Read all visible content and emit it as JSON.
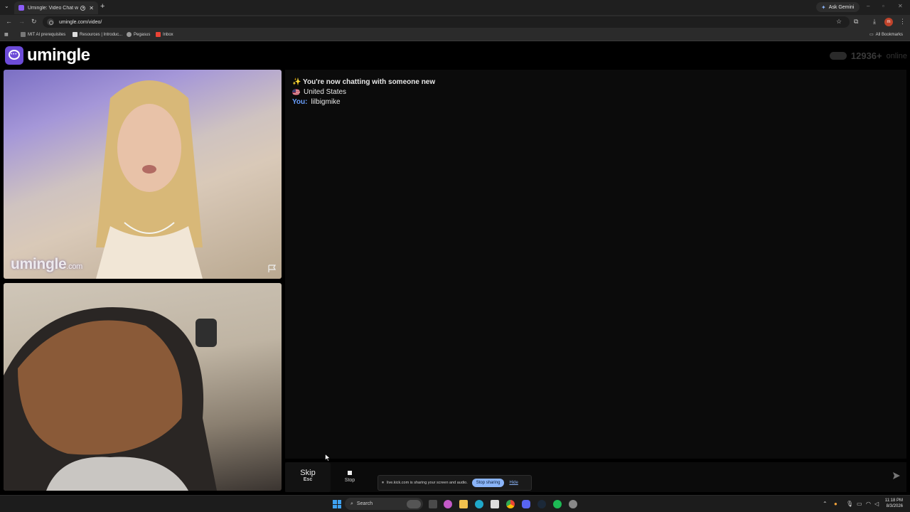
{
  "browser": {
    "tab_title": "Umingle: Video Chat with S",
    "url": "umingle.com/video/",
    "ask_gemini": "Ask Gemini",
    "profile_initial": "m",
    "bookmarks": [
      "MIT AI prerequisites",
      "Resources | Introduc...",
      "Pegasus",
      "Inbox"
    ],
    "all_bookmarks": "All Bookmarks"
  },
  "site": {
    "logo_text": "umingle",
    "online_count": "12936+",
    "online_label": "online",
    "watermark_main": "umingle",
    "watermark_suffix": ".com"
  },
  "chat": {
    "system_message": "✨ You're now chatting with someone new",
    "country": "United States",
    "you_label": "You:",
    "you_message": "lilbigmike"
  },
  "controls": {
    "skip_label": "Skip",
    "skip_hint": "Esc",
    "stop_label": "Stop"
  },
  "share_bar": {
    "message": "live.kick.com is sharing your screen and audio.",
    "stop_sharing": "Stop sharing",
    "hide": "Hide"
  },
  "taskbar": {
    "search_placeholder": "Search",
    "time": "11:18 PM",
    "date": "8/3/2026"
  },
  "colors": {
    "brand": "#6c4bd8",
    "you_label": "#6aa0ff",
    "accent_blue": "#8ab4f8"
  }
}
